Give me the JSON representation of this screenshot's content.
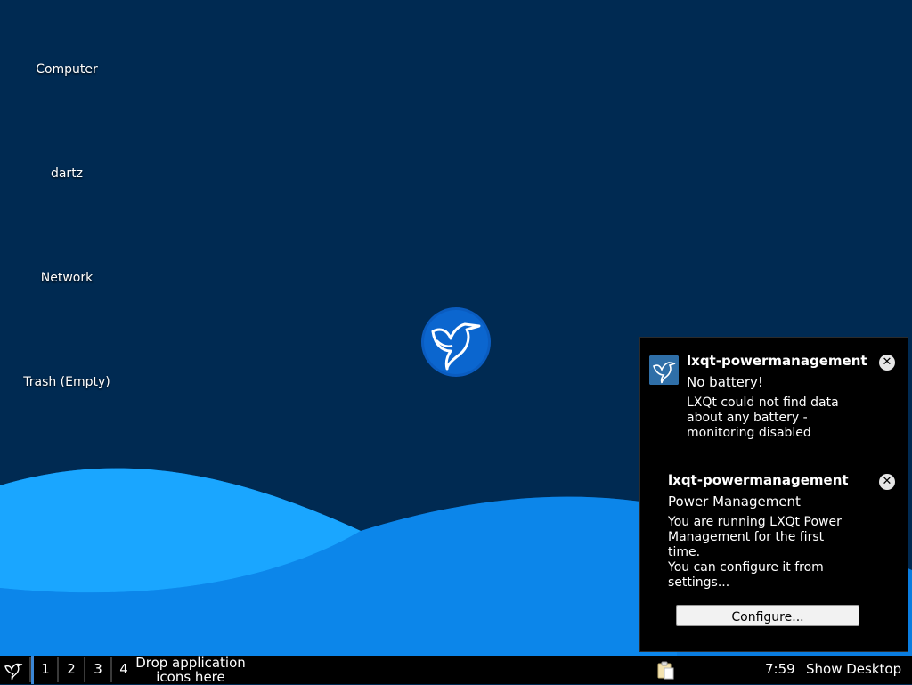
{
  "desktop": {
    "icons": [
      {
        "label": "Computer"
      },
      {
        "label": "dartz"
      },
      {
        "label": "Network"
      },
      {
        "label": "Trash (Empty)"
      }
    ]
  },
  "notifications": [
    {
      "app": "lxqt-powermanagement",
      "summary": "No battery!",
      "body": "LXQt could not find data\nabout any battery -\nmonitoring disabled",
      "close_glyph": "✕"
    },
    {
      "app": "lxqt-powermanagement",
      "summary": "Power Management",
      "body": "You are running LXQt Power\nManagement for the first\ntime.\nYou can configure it from\nsettings...",
      "action_label": "Configure...",
      "close_glyph": "✕"
    }
  ],
  "taskbar": {
    "workspaces": [
      "1",
      "2",
      "3",
      "4"
    ],
    "active_workspace": "1",
    "quicklaunch_hint": "Drop application\nicons here",
    "clock": "7:59",
    "show_desktop": "Show Desktop"
  },
  "colors": {
    "desktop_bg": "#002a52",
    "wave_light": "#1aa6ff",
    "wave_dark": "#0a7de0",
    "panel_bg": "#000000",
    "accent": "#3b87d6"
  },
  "icons": {
    "menu": "lxqt-bird-icon",
    "clipboard": "clipboard-icon",
    "close": "close-icon",
    "logo": "lxqt-bird-logo"
  }
}
